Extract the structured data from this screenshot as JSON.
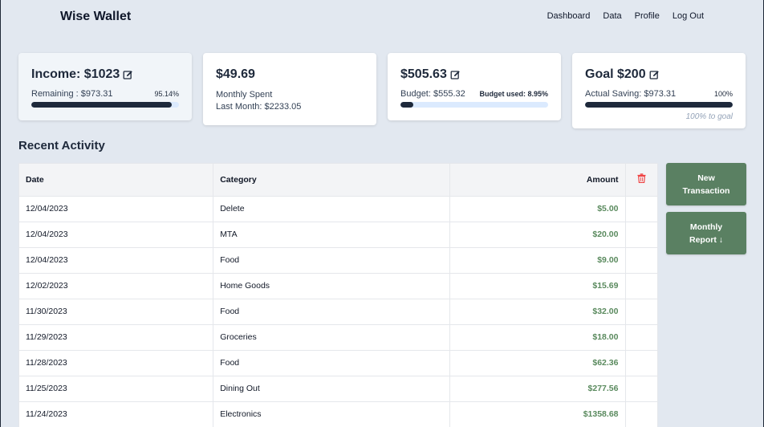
{
  "header": {
    "brand": "Wise Wallet",
    "nav": [
      "Dashboard",
      "Data",
      "Profile",
      "Log Out"
    ]
  },
  "cards": {
    "income": {
      "title": "Income: $1023",
      "remaining": "Remaining : $973.31",
      "percent": "95.14%",
      "progress": 0.9514
    },
    "spent": {
      "title": "$49.69",
      "line1": "Monthly Spent",
      "line2": "Last Month: $2233.05"
    },
    "budget": {
      "title": "$505.63",
      "budget": "Budget: $555.32",
      "used": "Budget used: 8.95%",
      "progress": 0.0895
    },
    "goal": {
      "title": "Goal $200",
      "saving": "Actual Saving: $973.31",
      "percent": "100%",
      "progress": 1.0,
      "note": "100% to goal"
    }
  },
  "activity": {
    "title": "Recent Activity",
    "columns": {
      "date": "Date",
      "category": "Category",
      "amount": "Amount"
    },
    "rows": [
      {
        "date": "12/04/2023",
        "category": "Delete",
        "amount": "$5.00"
      },
      {
        "date": "12/04/2023",
        "category": "MTA",
        "amount": "$20.00"
      },
      {
        "date": "12/04/2023",
        "category": "Food",
        "amount": "$9.00"
      },
      {
        "date": "12/02/2023",
        "category": "Home Goods",
        "amount": "$15.69"
      },
      {
        "date": "11/30/2023",
        "category": "Food",
        "amount": "$32.00"
      },
      {
        "date": "11/29/2023",
        "category": "Groceries",
        "amount": "$18.00"
      },
      {
        "date": "11/28/2023",
        "category": "Food",
        "amount": "$62.36"
      },
      {
        "date": "11/25/2023",
        "category": "Dining Out",
        "amount": "$277.56"
      },
      {
        "date": "11/24/2023",
        "category": "Electronics",
        "amount": "$1358.68"
      }
    ]
  },
  "actions": {
    "new_transaction": [
      "New",
      "Transaction"
    ],
    "monthly_report": [
      "Monthly",
      "Report ↓"
    ]
  },
  "colors": {
    "accent": "#5a8062",
    "amount": "#5a8a5e",
    "trash": "#ef4444",
    "bar": "#1e293b",
    "bar_track": "#dbeafe"
  }
}
